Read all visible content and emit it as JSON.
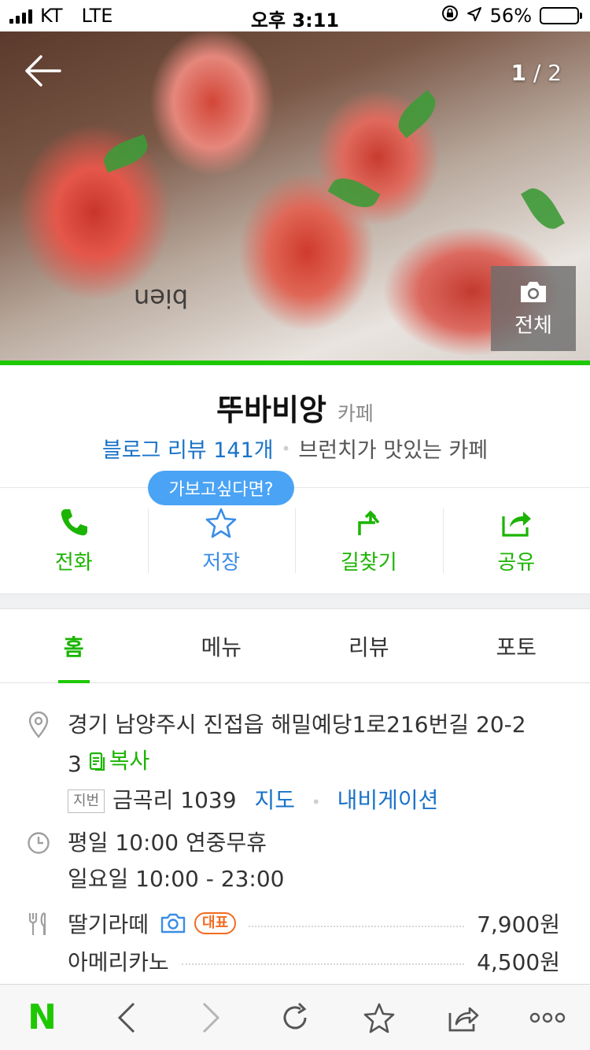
{
  "status_bar": {
    "carrier": "KT",
    "network": "LTE",
    "time": "오후 3:11",
    "battery": "56%",
    "battery_level": 0.56
  },
  "hero": {
    "counter_current": "1",
    "counter_sep": " / ",
    "counter_total": "2",
    "all_photos_label": "전체",
    "photo_text": "bien"
  },
  "place": {
    "name": "뚜바비앙",
    "category": "카페",
    "review_link": "블로그 리뷰 141개",
    "description": "브런치가 맛있는 카페"
  },
  "tooltip": "가보고싶다면?",
  "actions": [
    {
      "label": "전화",
      "icon": "phone-icon"
    },
    {
      "label": "저장",
      "icon": "star-icon"
    },
    {
      "label": "길찾기",
      "icon": "directions-icon"
    },
    {
      "label": "공유",
      "icon": "share-icon"
    }
  ],
  "tabs": [
    {
      "label": "홈",
      "active": true
    },
    {
      "label": "메뉴",
      "active": false
    },
    {
      "label": "리뷰",
      "active": false
    },
    {
      "label": "포토",
      "active": false
    }
  ],
  "info": {
    "address_line1": "경기 남양주시 진접읍 해밀예당1로216번길 20-2",
    "address_line2": "3",
    "copy_label": "복사",
    "jibeon_badge": "지번",
    "jibeon_address": "금곡리 1039",
    "map_link": "지도",
    "navigation_link": "내비게이션",
    "hours_line1": "평일 10:00 연중무휴",
    "hours_line2": "일요일 10:00 - 23:00",
    "menu": [
      {
        "name": "딸기라떼",
        "price": "7,900원",
        "has_photo": true,
        "badge": "대표"
      },
      {
        "name": "아메리카노",
        "price": "4,500원",
        "has_photo": false,
        "badge": ""
      }
    ]
  },
  "toolbar": {
    "logo": "N",
    "items": [
      "back-icon",
      "forward-icon",
      "reload-icon",
      "bookmark-icon",
      "share-icon",
      "more-icon"
    ]
  },
  "colors": {
    "naver_green": "#1ec800",
    "link_blue": "#1a73c8",
    "tooltip_blue": "#4aa3f5",
    "badge_orange": "#f36b21"
  }
}
